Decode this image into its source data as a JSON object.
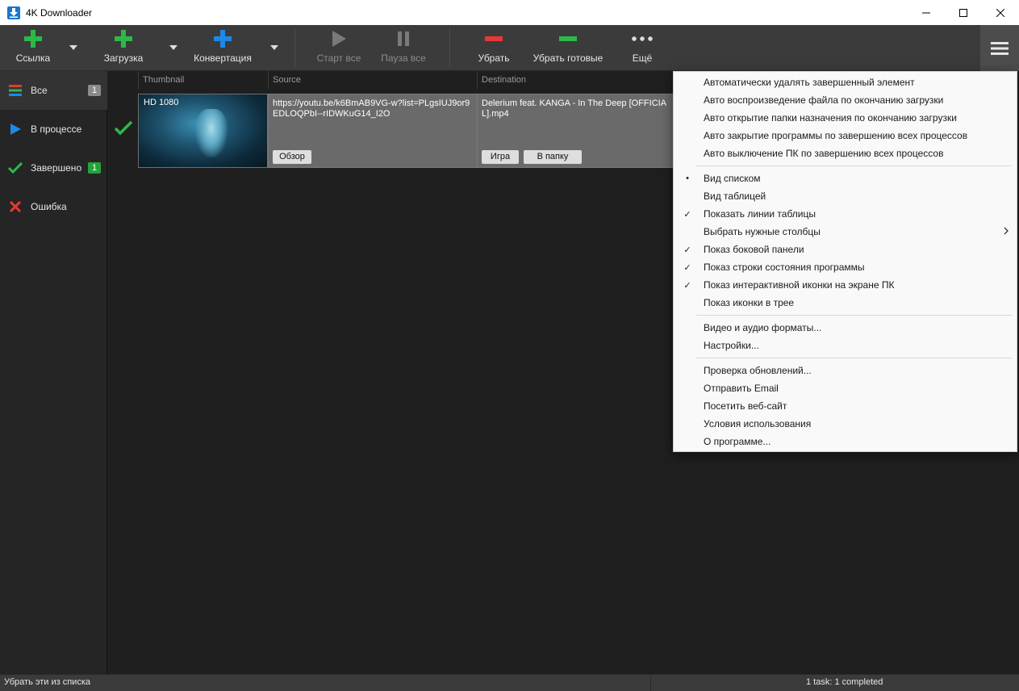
{
  "window": {
    "title": "4K Downloader",
    "controls": [
      "minimize",
      "maximize",
      "close"
    ]
  },
  "toolbar": {
    "link_label": "Ссылка",
    "download_label": "Загрузка",
    "convert_label": "Конвертация",
    "start_all_label": "Старт все",
    "pause_all_label": "Пауза все",
    "remove_label": "Убрать",
    "remove_done_label": "Убрать готовые",
    "more_label": "Ещё"
  },
  "sidebar": {
    "items": [
      {
        "label": "Все",
        "badge": "1",
        "icon": "list-icon"
      },
      {
        "label": "В процессе",
        "icon": "play-icon"
      },
      {
        "label": "Завершено",
        "badge": "1",
        "icon": "check-icon"
      },
      {
        "label": "Ошибка",
        "icon": "x-icon"
      }
    ]
  },
  "table": {
    "columns": [
      "Thumbnail",
      "Source",
      "Destination"
    ],
    "rows": [
      {
        "quality": "HD 1080",
        "source": "https://youtu.be/k6BmAB9VG-w?list=PLgsIUJ9or9EDLOQPbI--rIDWKuG14_I2O",
        "browse_label": "Обзор",
        "destination": "Delerium feat. KANGA - In The Deep [OFFICIAL].mp4",
        "play_label": "Игра",
        "folder_label": "В папку"
      }
    ]
  },
  "menu": {
    "group1": [
      {
        "label": "Автоматически удалять завершенный элемент",
        "mark": ""
      },
      {
        "label": "Авто воспроизведение файла по окончанию загрузки",
        "mark": ""
      },
      {
        "label": "Авто открытие папки назначения по окончанию загрузки",
        "mark": ""
      },
      {
        "label": "Авто закрытие программы по завершению всех процессов",
        "mark": ""
      },
      {
        "label": "Авто выключение ПК по завершению всех процессов",
        "mark": ""
      }
    ],
    "group2": [
      {
        "label": "Вид списком",
        "mark": "•"
      },
      {
        "label": "Вид таблицей",
        "mark": ""
      },
      {
        "label": "Показать линии таблицы",
        "mark": "✓"
      },
      {
        "label": "Выбрать нужные столбцы",
        "mark": "",
        "submenu": true
      },
      {
        "label": "Показ боковой панели",
        "mark": "✓"
      },
      {
        "label": "Показ строки состояния программы",
        "mark": "✓"
      },
      {
        "label": "Показ интерактивной иконки на экране ПК",
        "mark": "✓"
      },
      {
        "label": "Показ иконки в трее",
        "mark": ""
      }
    ],
    "group3": [
      {
        "label": "Видео и аудио форматы..."
      },
      {
        "label": "Настройки..."
      }
    ],
    "group4": [
      {
        "label": "Проверка обновлений..."
      },
      {
        "label": "Отправить Email"
      },
      {
        "label": "Посетить веб-сайт"
      },
      {
        "label": "Условия использования"
      },
      {
        "label": "О программе..."
      }
    ]
  },
  "statusbar": {
    "left": "Убрать эти из списка",
    "right": "1 task: 1 completed"
  },
  "colors": {
    "green": "#2db84a",
    "blue": "#1e88e5",
    "red": "#e53935"
  }
}
